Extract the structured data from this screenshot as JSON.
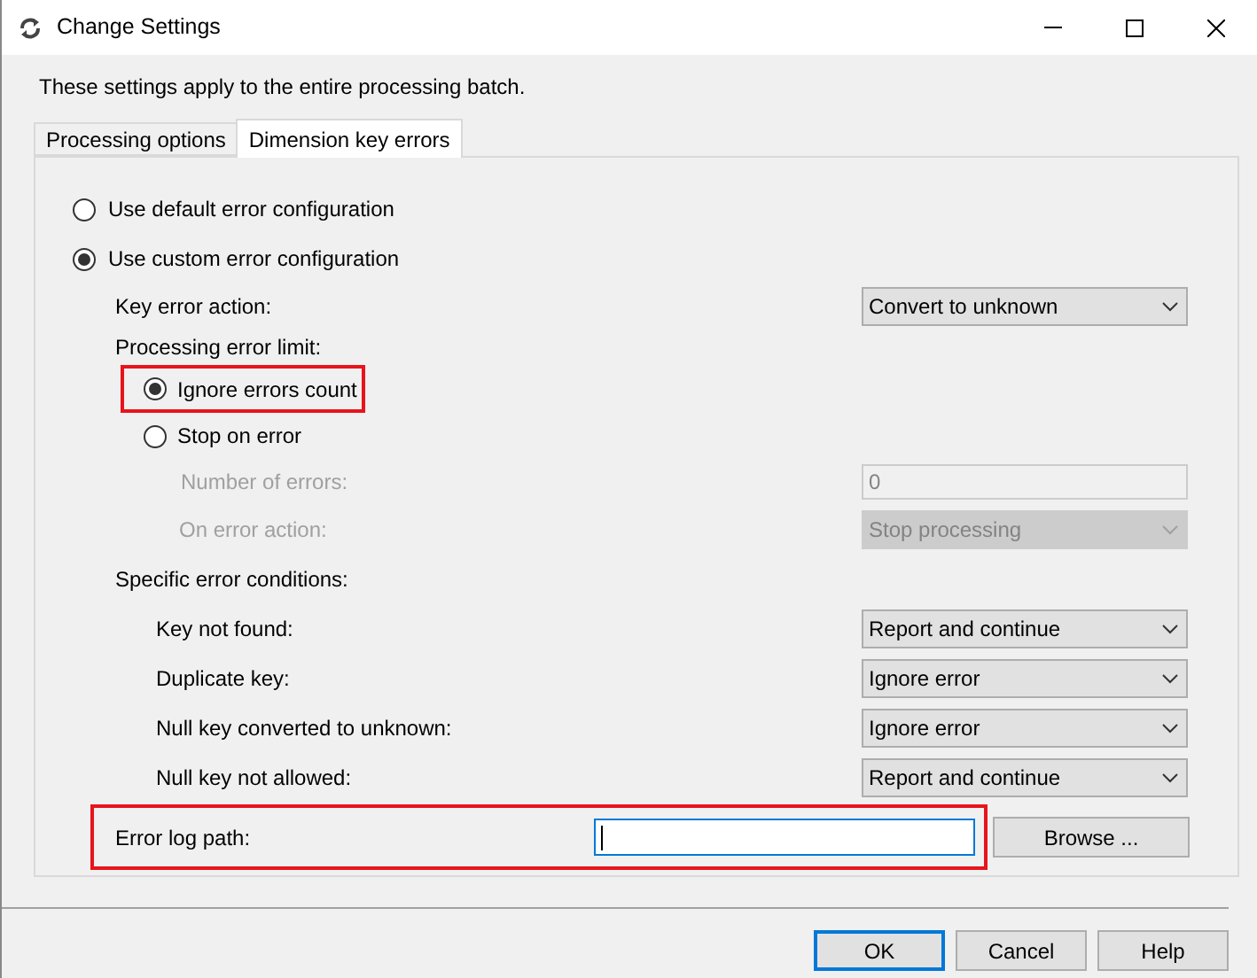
{
  "window": {
    "title": "Change Settings"
  },
  "intro": "These settings apply to the entire processing batch.",
  "tabs": [
    {
      "label": "Processing options",
      "selected": false
    },
    {
      "label": "Dimension key errors",
      "selected": true
    }
  ],
  "error_configuration": [
    {
      "label": "Use default error configuration",
      "selected": false
    },
    {
      "label": "Use custom error configuration",
      "selected": true
    }
  ],
  "key_error_action": {
    "label": "Key error action:",
    "value": "Convert to unknown"
  },
  "processing_error_limit": {
    "label": "Processing error limit:",
    "options": [
      {
        "label": "Ignore errors count",
        "selected": true,
        "highlighted": true
      },
      {
        "label": "Stop on error",
        "selected": false,
        "highlighted": false
      }
    ],
    "number_of_errors": {
      "label": "Number of errors:",
      "value": "0",
      "disabled": true
    },
    "on_error_action": {
      "label": "On error action:",
      "value": "Stop processing",
      "disabled": true
    }
  },
  "specific_error_conditions": {
    "label": "Specific error conditions:",
    "items": [
      {
        "label": "Key not found:",
        "value": "Report and continue"
      },
      {
        "label": "Duplicate key:",
        "value": "Ignore error"
      },
      {
        "label": "Null key converted to unknown:",
        "value": "Ignore error"
      },
      {
        "label": "Null key not allowed:",
        "value": "Report and continue"
      }
    ]
  },
  "error_log_path": {
    "label": "Error log path:",
    "highlighted": true,
    "focused": true
  },
  "browse_button": "Browse ...",
  "buttons": [
    {
      "label": "OK",
      "focused": true
    },
    {
      "label": "Cancel",
      "focused": false
    },
    {
      "label": "Help",
      "focused": false
    }
  ]
}
